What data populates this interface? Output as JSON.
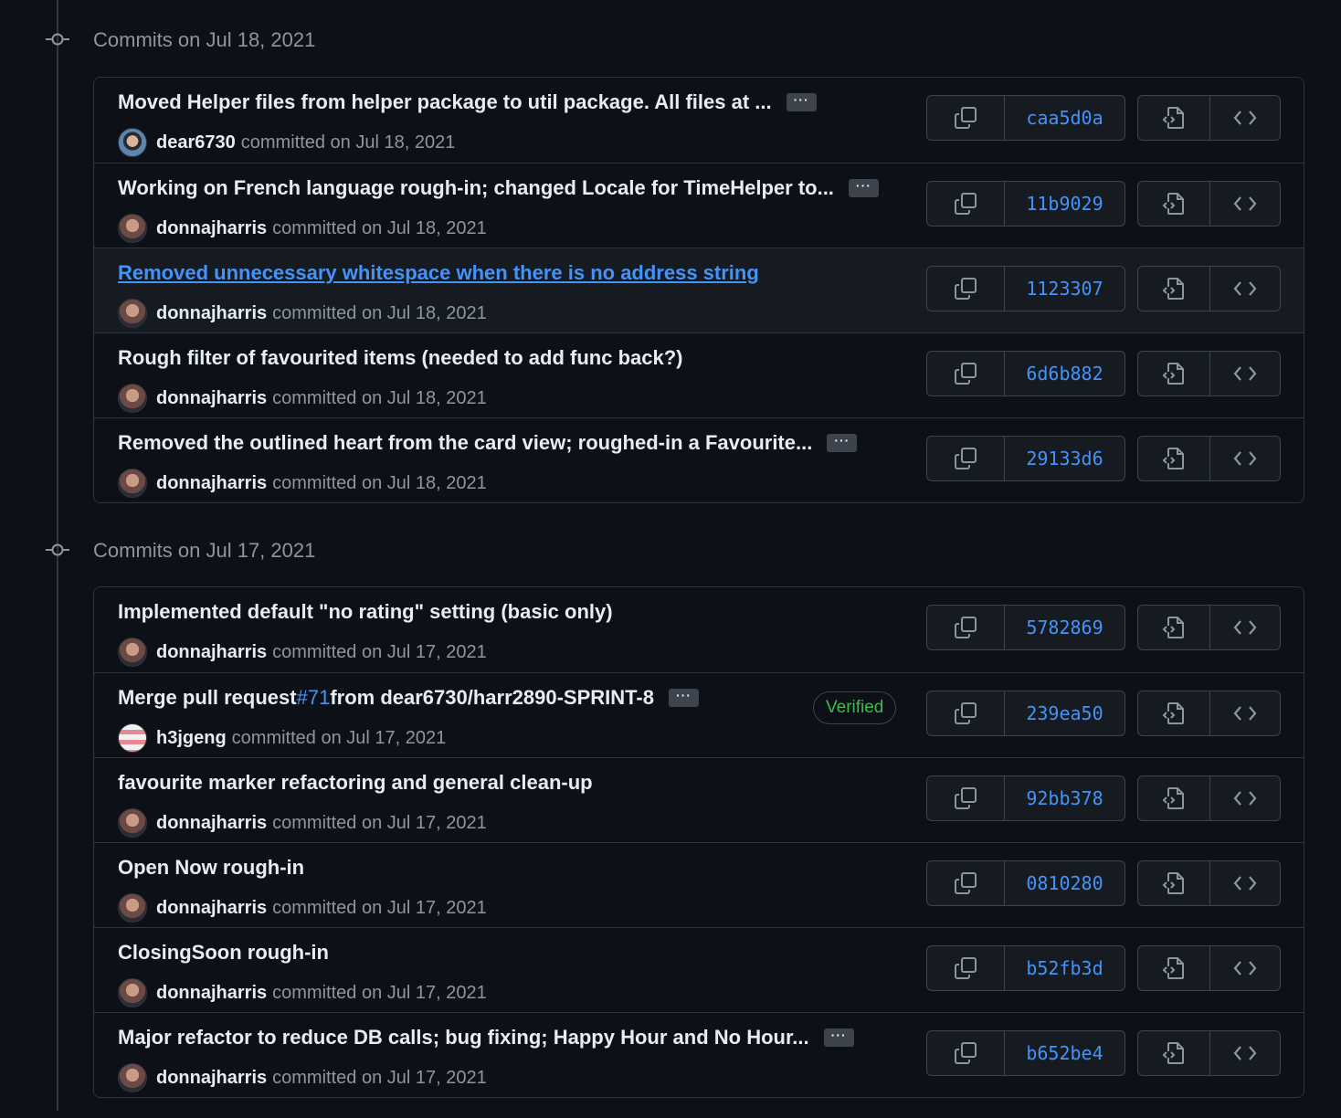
{
  "groups": [
    {
      "title": "Commits on Jul 18, 2021",
      "commits": [
        {
          "message": "Moved Helper files from helper package to util package. All files at ...",
          "ellipsis": true,
          "author": "dear6730",
          "avatar": "dear",
          "committed": "committed on Jul 18, 2021",
          "sha": "caa5d0a",
          "highlight": false,
          "link": false,
          "verified": ""
        },
        {
          "message": "Working on French language rough-in; changed Locale for TimeHelper to...",
          "ellipsis": true,
          "author": "donnajharris",
          "avatar": "donna",
          "committed": "committed on Jul 18, 2021",
          "sha": "11b9029",
          "highlight": false,
          "link": false,
          "verified": ""
        },
        {
          "message": "Removed unnecessary whitespace when there is no address string",
          "ellipsis": false,
          "author": "donnajharris",
          "avatar": "donna",
          "committed": "committed on Jul 18, 2021",
          "sha": "1123307",
          "highlight": true,
          "link": true,
          "verified": ""
        },
        {
          "message": "Rough filter of favourited items (needed to add func back?)",
          "ellipsis": false,
          "author": "donnajharris",
          "avatar": "donna",
          "committed": "committed on Jul 18, 2021",
          "sha": "6d6b882",
          "highlight": false,
          "link": false,
          "verified": ""
        },
        {
          "message": "Removed the outlined heart from the card view; roughed-in a Favourite...",
          "ellipsis": true,
          "author": "donnajharris",
          "avatar": "donna",
          "committed": "committed on Jul 18, 2021",
          "sha": "29133d6",
          "highlight": false,
          "link": false,
          "verified": ""
        }
      ]
    },
    {
      "title": "Commits on Jul 17, 2021",
      "commits": [
        {
          "message": "Implemented default \"no rating\" setting (basic only)",
          "ellipsis": false,
          "author": "donnajharris",
          "avatar": "donna",
          "committed": "committed on Jul 17, 2021",
          "sha": "5782869",
          "highlight": false,
          "link": false,
          "verified": ""
        },
        {
          "message_prefix": "Merge pull request ",
          "message_pr": "#71",
          "message_suffix": " from dear6730/harr2890-SPRINT-8",
          "ellipsis": true,
          "author": "h3jgeng",
          "avatar": "h3",
          "committed": "committed on Jul 17, 2021",
          "sha": "239ea50",
          "highlight": false,
          "link": false,
          "verified": "Verified"
        },
        {
          "message": "favourite marker refactoring and general clean-up",
          "ellipsis": false,
          "author": "donnajharris",
          "avatar": "donna",
          "committed": "committed on Jul 17, 2021",
          "sha": "92bb378",
          "highlight": false,
          "link": false,
          "verified": ""
        },
        {
          "message": "Open Now rough-in",
          "ellipsis": false,
          "author": "donnajharris",
          "avatar": "donna",
          "committed": "committed on Jul 17, 2021",
          "sha": "0810280",
          "highlight": false,
          "link": false,
          "verified": ""
        },
        {
          "message": "ClosingSoon rough-in",
          "ellipsis": false,
          "author": "donnajharris",
          "avatar": "donna",
          "committed": "committed on Jul 17, 2021",
          "sha": "b52fb3d",
          "highlight": false,
          "link": false,
          "verified": ""
        },
        {
          "message": "Major refactor to reduce DB calls; bug fixing; Happy Hour and No Hour...",
          "ellipsis": true,
          "author": "donnajharris",
          "avatar": "donna",
          "committed": "committed on Jul 17, 2021",
          "sha": "b652be4",
          "highlight": false,
          "link": false,
          "verified": ""
        }
      ]
    }
  ],
  "ellipsis_label": "···",
  "icons": {
    "commit": "git-commit-icon",
    "copy": "copy-icon",
    "browse": "file-code-icon",
    "code": "code-icon"
  },
  "colors": {
    "background": "#0d1117",
    "link": "#4493f8",
    "verified": "#3fb950",
    "muted": "#8d96a0"
  }
}
